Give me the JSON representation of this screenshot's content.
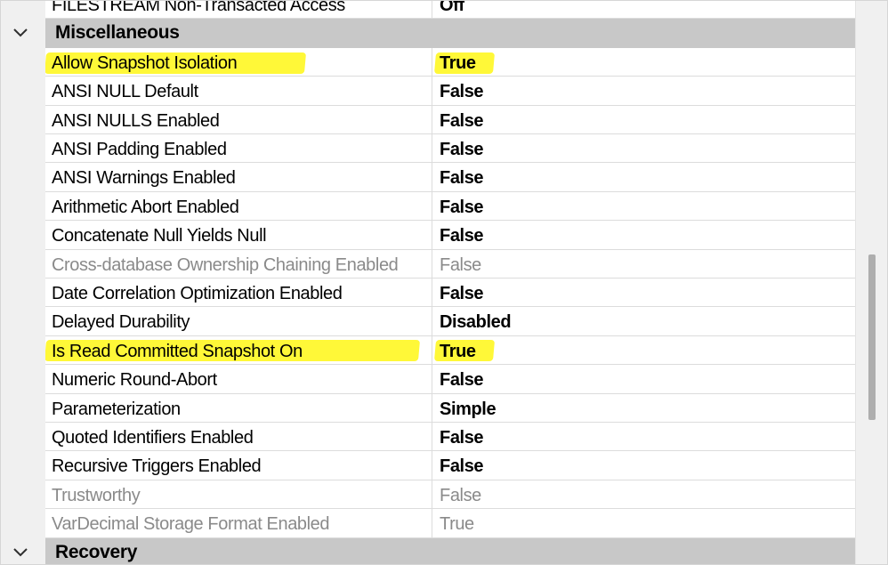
{
  "grid": {
    "previous_row": {
      "name": "FILESTREAM Non-Transacted Access",
      "value": "Off"
    },
    "sections": [
      {
        "title": "Miscellaneous",
        "expanded": true,
        "properties": [
          {
            "name": "Allow Snapshot Isolation",
            "value": "True",
            "readonly": false,
            "highlighted": true
          },
          {
            "name": "ANSI NULL Default",
            "value": "False",
            "readonly": false,
            "highlighted": false
          },
          {
            "name": "ANSI NULLS Enabled",
            "value": "False",
            "readonly": false,
            "highlighted": false
          },
          {
            "name": "ANSI Padding Enabled",
            "value": "False",
            "readonly": false,
            "highlighted": false
          },
          {
            "name": "ANSI Warnings Enabled",
            "value": "False",
            "readonly": false,
            "highlighted": false
          },
          {
            "name": "Arithmetic Abort Enabled",
            "value": "False",
            "readonly": false,
            "highlighted": false
          },
          {
            "name": "Concatenate Null Yields Null",
            "value": "False",
            "readonly": false,
            "highlighted": false
          },
          {
            "name": "Cross-database Ownership Chaining Enabled",
            "value": "False",
            "readonly": true,
            "highlighted": false
          },
          {
            "name": "Date Correlation Optimization Enabled",
            "value": "False",
            "readonly": false,
            "highlighted": false
          },
          {
            "name": "Delayed Durability",
            "value": "Disabled",
            "readonly": false,
            "highlighted": false
          },
          {
            "name": "Is Read Committed Snapshot On",
            "value": "True",
            "readonly": false,
            "highlighted": true
          },
          {
            "name": "Numeric Round-Abort",
            "value": "False",
            "readonly": false,
            "highlighted": false
          },
          {
            "name": "Parameterization",
            "value": "Simple",
            "readonly": false,
            "highlighted": false
          },
          {
            "name": "Quoted Identifiers Enabled",
            "value": "False",
            "readonly": false,
            "highlighted": false
          },
          {
            "name": "Recursive Triggers Enabled",
            "value": "False",
            "readonly": false,
            "highlighted": false
          },
          {
            "name": "Trustworthy",
            "value": "False",
            "readonly": true,
            "highlighted": false
          },
          {
            "name": "VarDecimal Storage Format Enabled",
            "value": "True",
            "readonly": true,
            "highlighted": false
          }
        ]
      },
      {
        "title": "Recovery",
        "expanded": true,
        "properties": []
      }
    ]
  },
  "colors": {
    "highlight": "#fff600",
    "section_band": "#c8c8c8",
    "gutter": "#f0f0f0",
    "grid_line": "#dcdcdc",
    "readonly_text": "#8a8a8a"
  },
  "icons": {
    "section_expander": "chevron-down-icon"
  }
}
